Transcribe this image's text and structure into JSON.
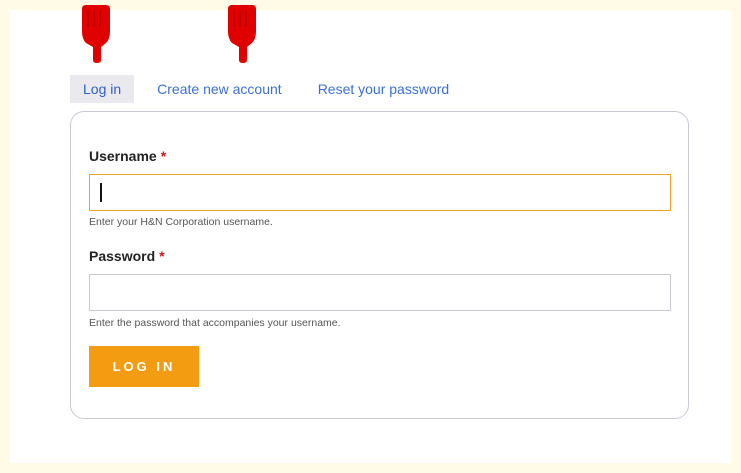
{
  "tabs": [
    {
      "label": "Log in",
      "active": true
    },
    {
      "label": "Create new account",
      "active": false
    },
    {
      "label": "Reset your password",
      "active": false
    }
  ],
  "form": {
    "username": {
      "label": "Username",
      "required_mark": "*",
      "value": "",
      "hint": "Enter your H&N Corporation username."
    },
    "password": {
      "label": "Password",
      "required_mark": "*",
      "value": "",
      "hint": "Enter the password that accompanies your username."
    },
    "submit_label": "LOG IN"
  },
  "annotations": {
    "pointer_icon": "pointing-hand-down-icon",
    "pointer_color": "#e00000"
  },
  "colors": {
    "page_background": "#fffbe6",
    "link": "#3b6fd6",
    "active_tab_bg": "#e9e9ee",
    "focus_border": "#f0a427",
    "button": "#f39c12",
    "required": "#d01818"
  }
}
